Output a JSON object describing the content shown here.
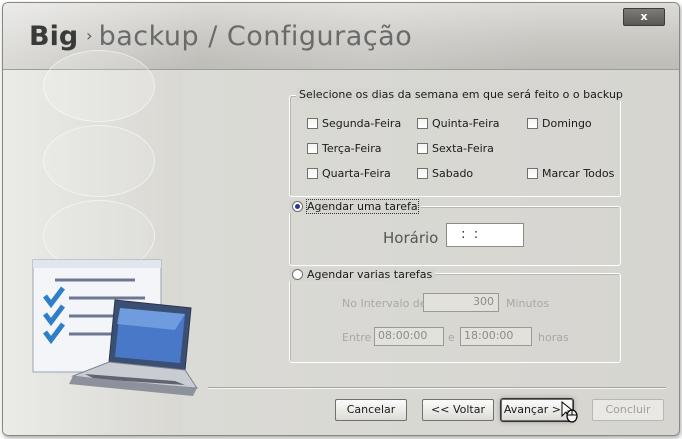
{
  "window": {
    "title_bold": "Big",
    "title_sep": "›",
    "title_rest": "backup / Configuração",
    "close_label": "x"
  },
  "days": {
    "legend": "Selecione os dias da semana em que será feito o o backup",
    "items": [
      {
        "label": "Segunda-Feira",
        "checked": false
      },
      {
        "label": "Quinta-Feira",
        "checked": false
      },
      {
        "label": "Domingo",
        "checked": false
      },
      {
        "label": "Terça-Feira",
        "checked": false
      },
      {
        "label": "Sexta-Feira",
        "checked": false
      },
      {
        "label": "Quarta-Feira",
        "checked": false
      },
      {
        "label": "Sabado",
        "checked": false
      },
      {
        "label": "Marcar Todos",
        "checked": false
      }
    ]
  },
  "single": {
    "radio_label": "Agendar uma tarefa",
    "selected": true,
    "time_label": "Horário",
    "time_value": " :  : "
  },
  "multi": {
    "radio_label": "Agendar varias tarefas",
    "selected": false,
    "interval_label": "No Intervalo de",
    "interval_value": "300",
    "interval_unit": "Minutos",
    "between_label": "Entre",
    "from_value": "08:00:00",
    "and_label": "e",
    "to_value": "18:00:00",
    "hours_unit": "horas"
  },
  "buttons": {
    "cancel": "Cancelar",
    "back": "<< Voltar",
    "next": "Avançar >>",
    "finish": "Concluir"
  }
}
